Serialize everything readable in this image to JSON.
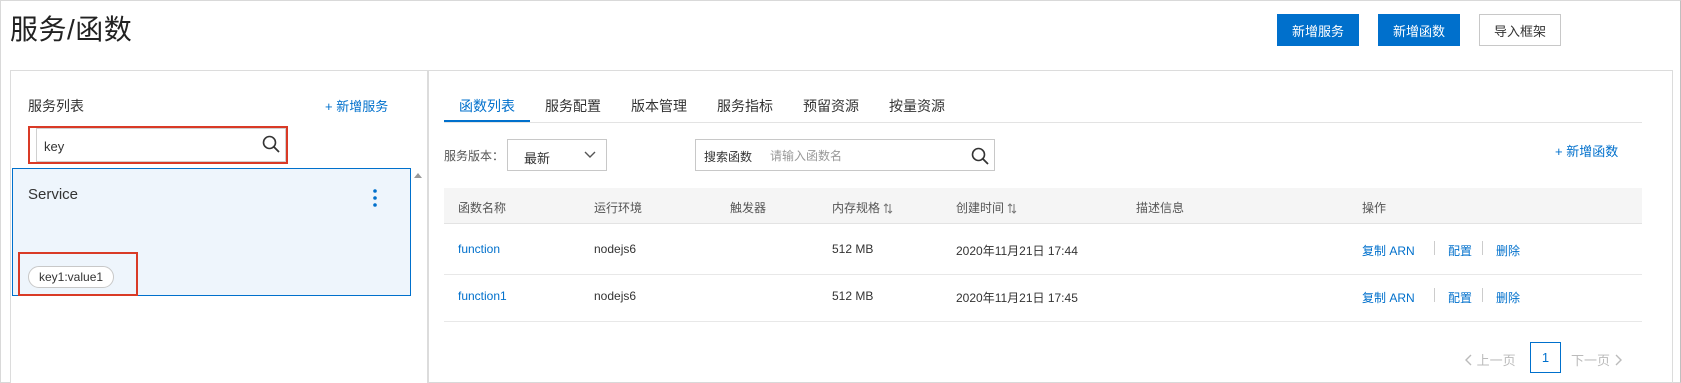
{
  "page": {
    "title": "服务/函数"
  },
  "header_buttons": {
    "new_service": "新增服务",
    "new_function": "新增函数",
    "import_framework": "导入框架"
  },
  "service_panel": {
    "title": "服务列表",
    "add_service": "+ 新增服务",
    "search_value": "key",
    "services": [
      {
        "name": "Service",
        "tag": "key1:value1"
      }
    ]
  },
  "tabs": [
    {
      "label": "函数列表",
      "active": true
    },
    {
      "label": "服务配置",
      "active": false
    },
    {
      "label": "版本管理",
      "active": false
    },
    {
      "label": "服务指标",
      "active": false
    },
    {
      "label": "预留资源",
      "active": false
    },
    {
      "label": "按量资源",
      "active": false
    }
  ],
  "toolbar": {
    "version_label": "服务版本：",
    "version_value": "最新",
    "search_label": "搜索函数",
    "search_placeholder": "请输入函数名",
    "add_function": "+ 新增函数"
  },
  "table": {
    "columns": [
      "函数名称",
      "运行环境",
      "触发器",
      "内存规格",
      "创建时间",
      "描述信息",
      "操作"
    ],
    "rows": [
      {
        "name": "function",
        "runtime": "nodejs6",
        "trigger": "",
        "memory": "512 MB",
        "created": "2020年11月21日 17:44",
        "description": "",
        "actions": [
          "复制 ARN",
          "配置",
          "删除"
        ]
      },
      {
        "name": "function1",
        "runtime": "nodejs6",
        "trigger": "",
        "memory": "512 MB",
        "created": "2020年11月21日 17:45",
        "description": "",
        "actions": [
          "复制 ARN",
          "配置",
          "删除"
        ]
      }
    ]
  },
  "pagination": {
    "prev": "上一页",
    "current": "1",
    "next": "下一页"
  },
  "colors": {
    "primary": "#0070cc",
    "highlight": "#d93a26"
  }
}
